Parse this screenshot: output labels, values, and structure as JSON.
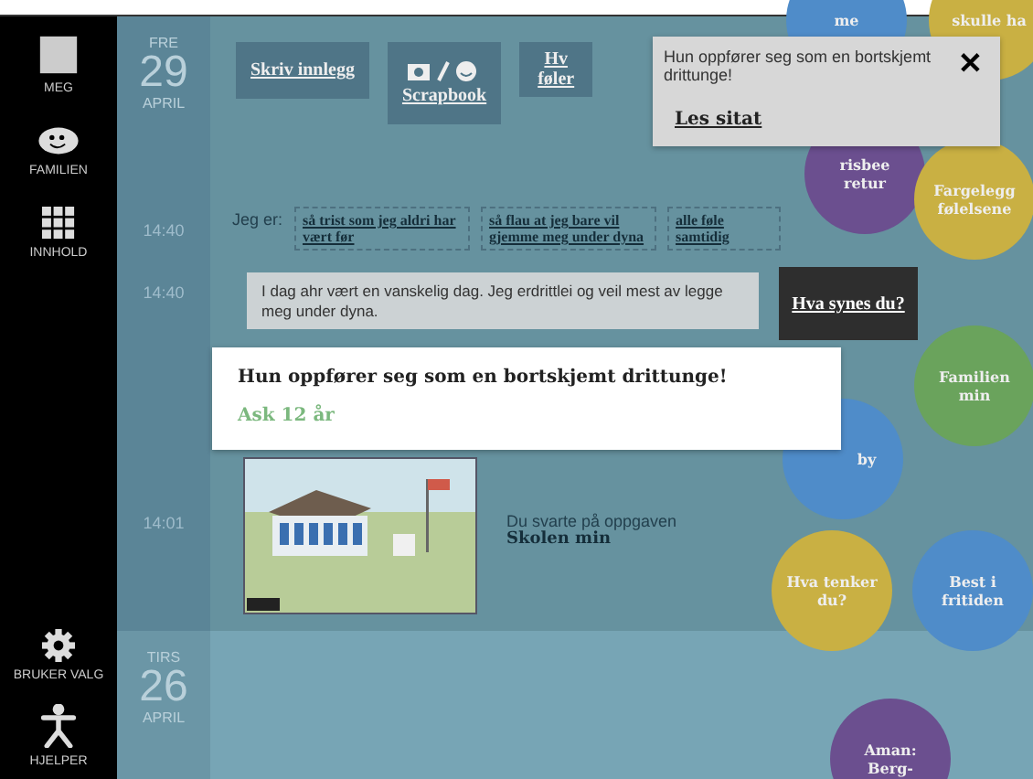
{
  "sidebar": {
    "top": [
      {
        "label": "MEG",
        "kind": "square"
      },
      {
        "label": "FAMILIEN",
        "kind": "family"
      },
      {
        "label": "INNHOLD",
        "kind": "grid"
      }
    ],
    "bottom": [
      {
        "label": "BRUKER VALG",
        "kind": "gear"
      },
      {
        "label": "HJELPER",
        "kind": "person"
      }
    ]
  },
  "days": [
    {
      "weekday": "FRE",
      "day": "29",
      "month": "APRIL",
      "toolbar": [
        {
          "kind": "write",
          "label": "Skriv innlegg"
        },
        {
          "kind": "scrapbook",
          "label": "Scrapbook"
        },
        {
          "kind": "write",
          "label": "Hv føler"
        }
      ],
      "entries": [
        {
          "kind": "mood",
          "time": "14:40",
          "prefix": "Jeg er:",
          "options": [
            "så trist som jeg aldri har vært før",
            "så flau at jeg bare vil gjemme meg under dyna",
            "alle føle samtidig"
          ]
        },
        {
          "kind": "post",
          "time": "14:40",
          "text": "I dag ahr vært en vanskelig dag. Jeg erdrittlei og veil mest av legge meg under dyna."
        },
        {
          "kind": "task",
          "time": "14:01",
          "lead": "Du svarte på oppgaven",
          "title": "Skolen min"
        }
      ]
    },
    {
      "weekday": "TIRS",
      "day": "26",
      "month": "APRIL"
    }
  ],
  "quote_card": {
    "text": "Hun oppfører seg som en bortskjemt drittunge!",
    "author": "Ask 12 år"
  },
  "callout": {
    "label": "Hva synes du?"
  },
  "notification": {
    "text": "Hun oppfører seg som en bortskjemt drittunge!",
    "link": "Les sitat",
    "close": "✕"
  },
  "bubbles": [
    {
      "label": "me",
      "color": "#4f8cc9"
    },
    {
      "label": "skulle ha",
      "color": "#c9b043"
    },
    {
      "label": "risbee retur",
      "color": "#6b4f8f"
    },
    {
      "label": "Fargelegg følelsene",
      "color": "#c9b043"
    },
    {
      "label": "Familien min",
      "color": "#6aa35c"
    },
    {
      "label": "by",
      "color": "#4f8cc9"
    },
    {
      "label": "Hva tenker du?",
      "color": "#c9b043"
    },
    {
      "label": "Best i fritiden",
      "color": "#4f8cc9"
    },
    {
      "label": "Aman: Berg-",
      "color": "#6b4f8f"
    }
  ]
}
